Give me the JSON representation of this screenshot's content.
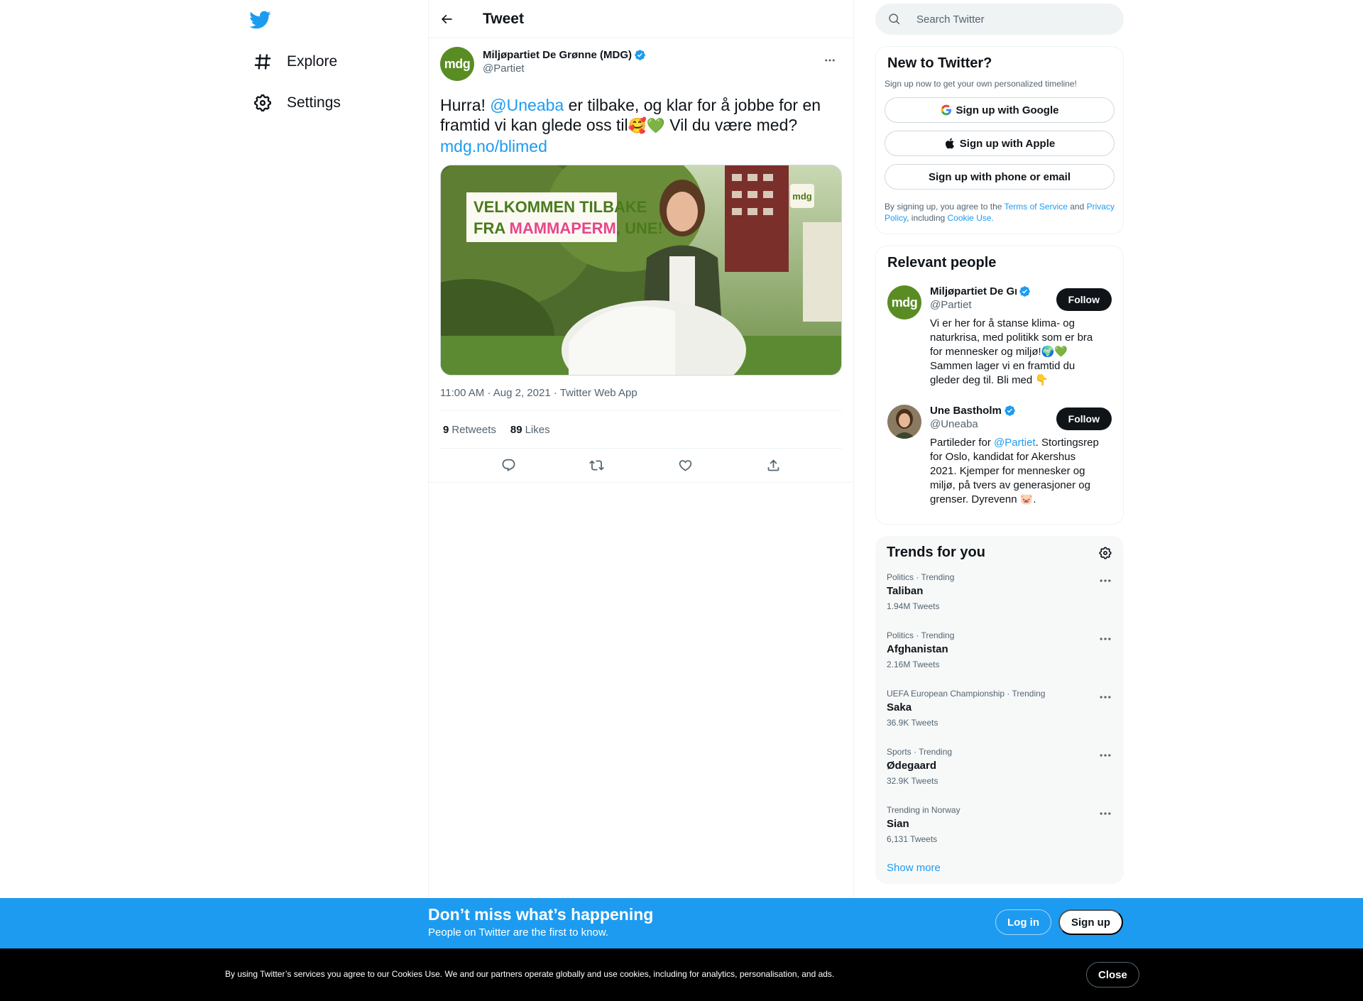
{
  "nav": {
    "explore_label": "Explore",
    "settings_label": "Settings"
  },
  "header": {
    "title": "Tweet"
  },
  "tweet": {
    "author_name": "Miljøpartiet De Grønne (MDG)",
    "author_handle": "@Partiet",
    "avatar_text": "mdg",
    "text_start": "Hurra! ",
    "mention": "@Uneaba",
    "text_mid": " er tilbake, og klar for å jobbe for en framtid vi kan glede oss til",
    "emoji": "🥰💚",
    "text_end": " Vil du være med?",
    "link": "mdg.no/blimed",
    "image": {
      "banner_line1": "VELKOMMEN TILBAKE",
      "banner_line2a": "FRA ",
      "banner_line2b": "MAMMAPERM",
      "banner_line2c": ", UNE!",
      "badge": "mdg"
    },
    "meta": "11:00 AM · Aug 2, 2021 · Twitter Web App",
    "retweets_count": "9",
    "retweets_label": "Retweets",
    "likes_count": "89",
    "likes_label": "Likes"
  },
  "search": {
    "placeholder": "Search Twitter"
  },
  "new_to_twitter": {
    "title": "New to Twitter?",
    "subtitle": "Sign up now to get your own personalized timeline!",
    "google": "Sign up with Google",
    "apple": "Sign up with Apple",
    "phone": "Sign up with phone or email",
    "legal_1": "By signing up, you agree to the ",
    "terms": "Terms of Service",
    "legal_2": " and ",
    "privacy": "Privacy Policy",
    "legal_3": ", including ",
    "cookie": "Cookie Use."
  },
  "relevant_people": {
    "title": "Relevant people",
    "people": [
      {
        "name": "Miljøpartiet De Grønne (MDG)",
        "handle": "@Partiet",
        "avatar_text": "mdg",
        "follow": "Follow",
        "bio": "Vi er her for å stanse klima- og naturkrisa, med politikk som er bra for mennesker og miljø!🌍💚 Sammen lager vi en framtid du gleder deg til. Bli med 👇"
      },
      {
        "name": "Une Bastholm",
        "handle": "@Uneaba",
        "follow": "Follow",
        "bio_1": "Partileder for ",
        "bio_mention": "@Partiet",
        "bio_2": ". Stortingsrep for Oslo, kandidat for Akershus 2021. Kjemper for mennesker og miljø, på tvers av generasjoner og grenser. Dyrevenn 🐷."
      }
    ]
  },
  "trends": {
    "title": "Trends for you",
    "items": [
      {
        "context": "Politics · Trending",
        "name": "Taliban",
        "count": "1.94M Tweets"
      },
      {
        "context": "Politics · Trending",
        "name": "Afghanistan",
        "count": "2.16M Tweets"
      },
      {
        "context": "UEFA European Championship · Trending",
        "name": "Saka",
        "count": "36.9K Tweets"
      },
      {
        "context": "Sports · Trending",
        "name": "Ødegaard",
        "count": "32.9K Tweets"
      },
      {
        "context": "Trending in Norway",
        "name": "Sian",
        "count": "6,131 Tweets"
      }
    ],
    "show_more": "Show more"
  },
  "bottom_bar": {
    "title": "Don’t miss what’s happening",
    "subtitle": "People on Twitter are the first to know.",
    "login": "Log in",
    "signup": "Sign up"
  },
  "cookie_bar": {
    "text": "By using Twitter’s services you agree to our Cookies Use. We and our partners operate globally and use cookies, including for analytics, personalisation, and ads.",
    "close": "Close"
  },
  "colors": {
    "accent": "#1d9bf0",
    "mdg_green": "#5a8c24",
    "banner_green": "#4a7a1c",
    "banner_pink": "#e8458b"
  }
}
